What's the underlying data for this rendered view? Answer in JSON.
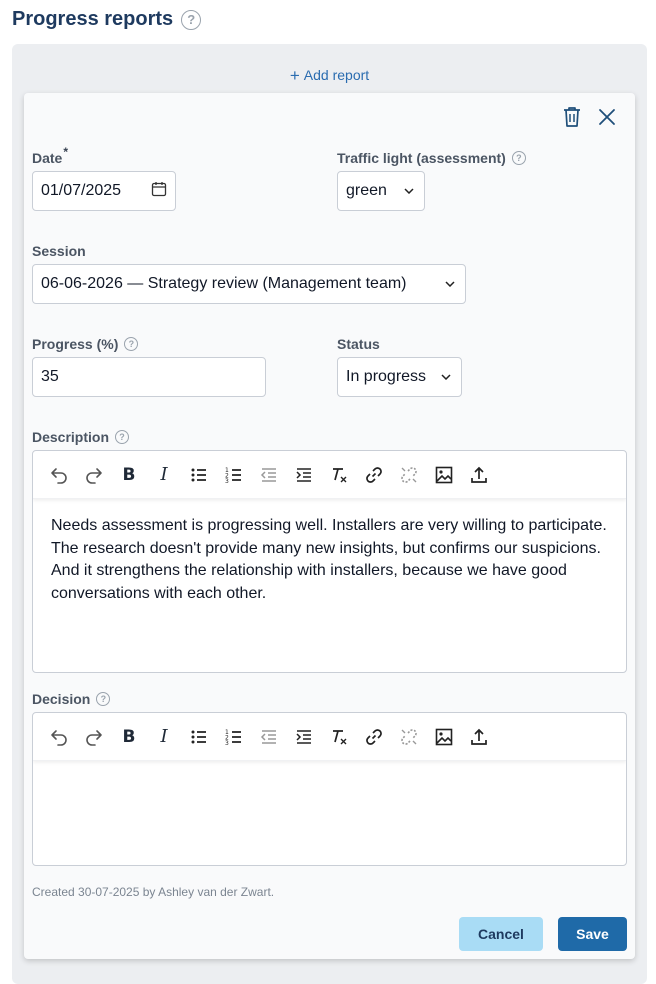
{
  "page": {
    "title": "Progress reports",
    "help_glyph": "?"
  },
  "panel": {
    "add_report_plus": "+",
    "add_report_label": "Add report"
  },
  "form": {
    "date": {
      "label": "Date",
      "required_mark": "*",
      "value": "01/07/2025"
    },
    "traffic_light": {
      "label": "Traffic light (assessment)",
      "value": "green"
    },
    "session": {
      "label": "Session",
      "value": "06-06-2026 — Strategy review (Management team)"
    },
    "progress": {
      "label": "Progress (%)",
      "value": "35"
    },
    "status": {
      "label": "Status",
      "value": "In progress"
    },
    "description": {
      "label": "Description",
      "content": "Needs assessment is progressing well. Installers are very willing to participate. The research doesn't provide many new insights, but confirms our suspicions. And it strengthens the relationship with installers, because we have good conversations with each other."
    },
    "decision": {
      "label": "Decision",
      "content": ""
    }
  },
  "toolbar_icons": [
    "undo-icon",
    "redo-icon",
    "bold-icon",
    "italic-icon",
    "bullet-list-icon",
    "numbered-list-icon",
    "outdent-icon",
    "indent-icon",
    "clear-format-icon",
    "link-icon",
    "unlink-icon",
    "image-icon",
    "upload-icon"
  ],
  "footer": {
    "created_text": "Created 30-07-2025 by Ashley van der Zwart.",
    "cancel_label": "Cancel",
    "save_label": "Save"
  },
  "colors": {
    "title": "#1e3a5f",
    "accent": "#2a6cb0",
    "save_button": "#1f6aa8",
    "cancel_button": "#a9dcf5",
    "panel_bg": "#eceef1"
  }
}
